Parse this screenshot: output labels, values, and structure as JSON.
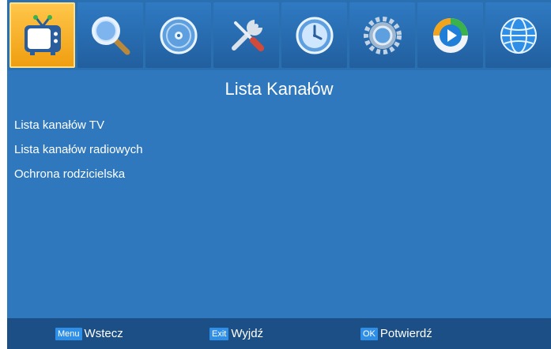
{
  "page": {
    "title": "Lista Kanałów"
  },
  "tabs": [
    {
      "icon": "tv-icon",
      "active": true
    },
    {
      "icon": "search-icon",
      "active": false
    },
    {
      "icon": "disc-icon",
      "active": false
    },
    {
      "icon": "tools-icon",
      "active": false
    },
    {
      "icon": "clock-icon",
      "active": false
    },
    {
      "icon": "gear-icon",
      "active": false
    },
    {
      "icon": "media-player-icon",
      "active": false
    },
    {
      "icon": "globe-icon",
      "active": false
    }
  ],
  "menu": [
    {
      "label": "Lista kanałów TV"
    },
    {
      "label": "Lista kanałów radiowych"
    },
    {
      "label": "Ochrona rodzicielska"
    }
  ],
  "footer": {
    "back": {
      "key": "Menu",
      "label": "Wstecz"
    },
    "exit": {
      "key": "Exit",
      "label": "Wyjdź"
    },
    "ok": {
      "key": "OK",
      "label": "Potwierdź"
    }
  },
  "colors": {
    "background": "#2f78bd",
    "active_tab": "#f5a623",
    "footer": "#1c4f85",
    "key_badge": "#2f8ee6"
  }
}
